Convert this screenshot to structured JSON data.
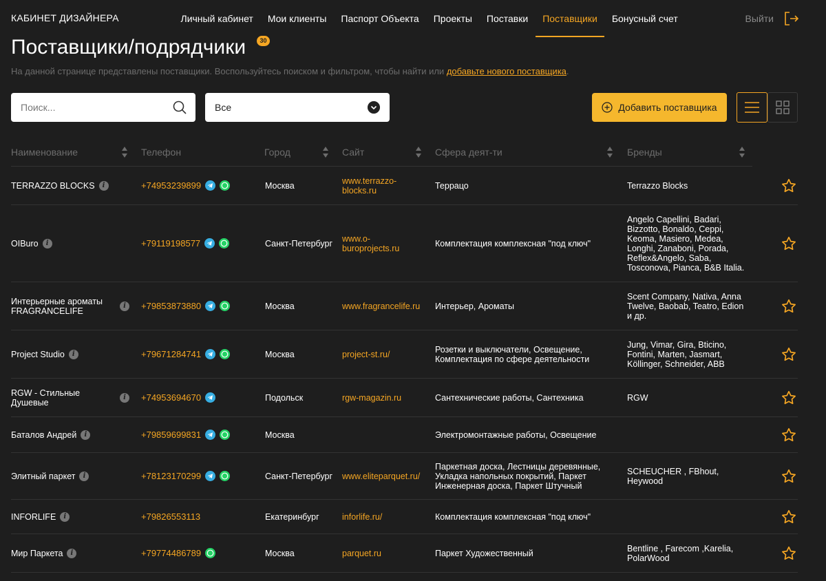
{
  "header": {
    "brand": "КАБИНЕТ ДИЗАЙНЕРА",
    "nav": [
      {
        "label": "Личный кабинет"
      },
      {
        "label": "Мои клиенты"
      },
      {
        "label": "Паспорт Объекта"
      },
      {
        "label": "Проекты"
      },
      {
        "label": "Поставки"
      },
      {
        "label": "Поставщики"
      },
      {
        "label": "Бонусный счет"
      }
    ],
    "active_nav": "Поставщики",
    "logout_label": "Выйти"
  },
  "page": {
    "title": "Поставщики/подрядчики",
    "count": "30",
    "subtitle": "На данной странице представлены поставщики. Воспользуйтесь поиском и фильтром, чтобы найти или ",
    "subtitle_link": "добавьте нового поставщика",
    "subtitle_end": "."
  },
  "toolbar": {
    "search_placeholder": "Поиск...",
    "filter_value": "Все",
    "add_label": "Добавить поставщика"
  },
  "table": {
    "columns": [
      "Наименование",
      "Телефон",
      "Город",
      "Сайт",
      "Сфера деят-ти",
      "Бренды"
    ],
    "rows": [
      {
        "name": "TERRAZZO BLOCKS",
        "phone": "+74953239899",
        "tg": true,
        "wa": true,
        "city": "Москва",
        "site": "www.terrazzo-blocks.ru",
        "sphere": "Террацо",
        "brands": "Terrazzo Blocks"
      },
      {
        "name": "OIBuro",
        "phone": "+79119198577",
        "tg": true,
        "wa": true,
        "city": "Санкт-Петербург",
        "site": "www.o-buroprojects.ru",
        "sphere": "Комплектация комплексная \"под ключ\"",
        "brands": "Angelo Capellini, Badari, Bizzotto, Bonaldo, Ceppi, Keoma, Masiero, Medea, Longhi, Zanaboni, Porada, Reflex&Angelo, Saba, Tosconova, Pianca, B&B Italia."
      },
      {
        "name": "Интерьерные ароматы FRAGRANCELIFE",
        "phone": "+79853873880",
        "tg": true,
        "wa": true,
        "city": "Москва",
        "site": "www.fragrancelife.ru",
        "sphere": "Интерьер, Ароматы",
        "brands": "Scent Company, Nativa, Anna Twelve, Baobab, Teatro, Edion и др."
      },
      {
        "name": "Project Studio",
        "phone": "+79671284741",
        "tg": true,
        "wa": true,
        "city": "Москва",
        "site": "project-st.ru/",
        "sphere": "Розетки и выключатели, Освещение, Комплектация по сфере деятельности",
        "brands": "Jung, Vimar, Gira, Bticino, Fontini, Marten, Jasmart, Köllinger, Schneider, ABB"
      },
      {
        "name": "RGW - Стильные Душевые",
        "phone": "+74953694670",
        "tg": true,
        "wa": false,
        "city": "Подольск",
        "site": "rgw-magazin.ru",
        "sphere": "Сантехнические работы, Сантехника",
        "brands": "RGW"
      },
      {
        "name": "Баталов Андрей",
        "phone": "+79859699831",
        "tg": true,
        "wa": true,
        "city": "Москва",
        "site": "",
        "sphere": "Электромонтажные работы, Освещение",
        "brands": ""
      },
      {
        "name": "Элитный паркет",
        "phone": "+78123170299",
        "tg": true,
        "wa": true,
        "city": "Санкт-Петербург",
        "site": "www.eliteparquet.ru/",
        "sphere": "Паркетная доска, Лестницы деревянные, Укладка напольных покрытий, Паркет Инженерная доска, Паркет Штучный",
        "brands": "SCHEUCHER , FBhout, Heywood"
      },
      {
        "name": "INFORLIFE",
        "phone": "+79826553113",
        "tg": false,
        "wa": false,
        "city": "Екатеринбург",
        "site": "inforlife.ru/",
        "sphere": "Комплектация комплексная \"под ключ\"",
        "brands": ""
      },
      {
        "name": "Мир Паркета",
        "phone": "+79774486789",
        "tg": false,
        "wa": true,
        "city": "Москва",
        "site": "parquet.ru",
        "sphere": "Паркет Художественный",
        "brands": "Bentline , Farecom ,Karelia, PolarWood"
      }
    ]
  },
  "colors": {
    "accent": "#f5a623",
    "background": "#1e1e1e",
    "telegram": "#37aee2",
    "whatsapp": "#25d366"
  }
}
